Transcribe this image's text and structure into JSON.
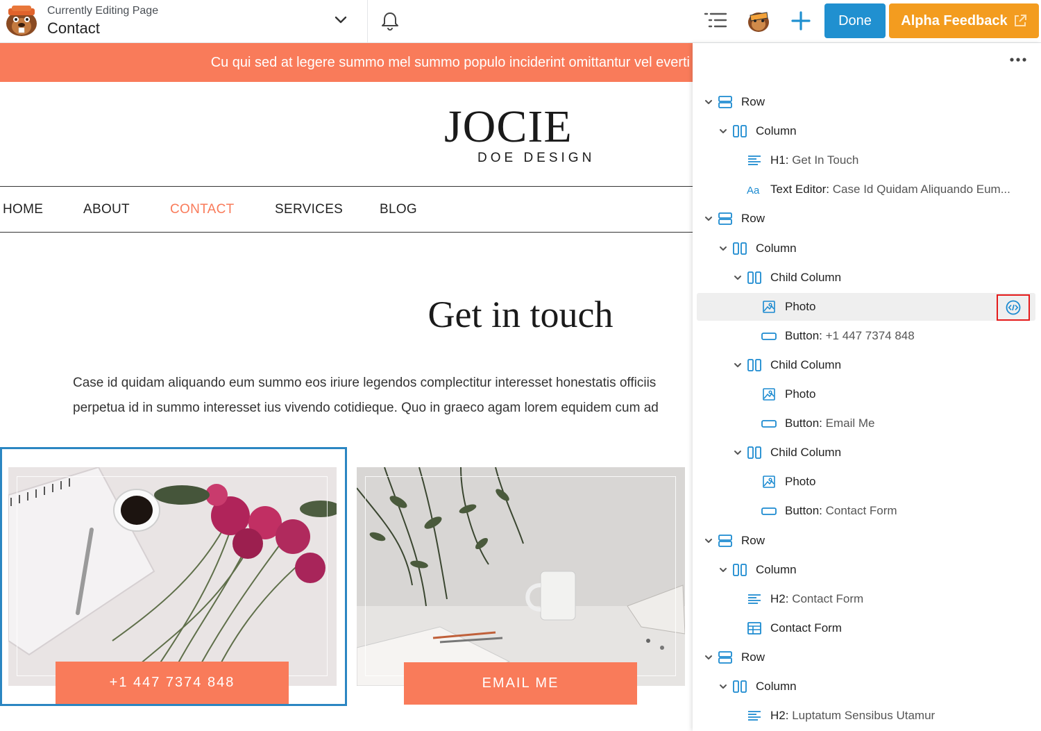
{
  "topbar": {
    "editing_label": "Currently Editing Page",
    "page_name": "Contact",
    "done_label": "Done",
    "feedback_label": "Alpha Feedback"
  },
  "site": {
    "announcement": "Cu qui sed at legere summo mel summo populo inciderint omittantur vel everti",
    "logo_main": "JOCIE",
    "logo_sub": "DOE DESIGN",
    "nav": [
      "HOME",
      "ABOUT",
      "CONTACT",
      "SERVICES",
      "BLOG"
    ],
    "nav_active": "CONTACT",
    "heading": "Get in touch",
    "body_lines": [
      "Case id quidam aliquando eum summo eos iriure legendos complectitur interesset honestatis officiis",
      "perpetua id in summo interesset ius vivendo cotidieque. Quo in graeco agam lorem equidem cum ad"
    ],
    "cta_phone": "+1 447 7374 848",
    "cta_email": "EMAIL ME"
  },
  "outline": {
    "items": [
      {
        "depth": 0,
        "icon": "row-icon",
        "type": "Row",
        "value": "",
        "expandable": true
      },
      {
        "depth": 1,
        "icon": "column-icon",
        "type": "Column",
        "value": "",
        "expandable": true
      },
      {
        "depth": 2,
        "icon": "heading-icon",
        "type": "H1:",
        "value": "Get In Touch",
        "expandable": false
      },
      {
        "depth": 2,
        "icon": "text-editor-icon",
        "type": "Text Editor:",
        "value": "Case Id Quidam Aliquando Eum...",
        "expandable": false
      },
      {
        "depth": 0,
        "icon": "row-icon",
        "type": "Row",
        "value": "",
        "expandable": true
      },
      {
        "depth": 1,
        "icon": "column-icon",
        "type": "Column",
        "value": "",
        "expandable": true
      },
      {
        "depth": 2,
        "icon": "column-icon",
        "type": "Child Column",
        "value": "",
        "expandable": true
      },
      {
        "depth": 3,
        "icon": "photo-icon",
        "type": "Photo",
        "value": "",
        "expandable": false,
        "highlight": true
      },
      {
        "depth": 3,
        "icon": "button-icon",
        "type": "Button:",
        "value": "+1 447 7374 848",
        "expandable": false
      },
      {
        "depth": 2,
        "icon": "column-icon",
        "type": "Child Column",
        "value": "",
        "expandable": true
      },
      {
        "depth": 3,
        "icon": "photo-icon",
        "type": "Photo",
        "value": "",
        "expandable": false
      },
      {
        "depth": 3,
        "icon": "button-icon",
        "type": "Button:",
        "value": "Email Me",
        "expandable": false
      },
      {
        "depth": 2,
        "icon": "column-icon",
        "type": "Child Column",
        "value": "",
        "expandable": true
      },
      {
        "depth": 3,
        "icon": "photo-icon",
        "type": "Photo",
        "value": "",
        "expandable": false
      },
      {
        "depth": 3,
        "icon": "button-icon",
        "type": "Button:",
        "value": "Contact Form",
        "expandable": false
      },
      {
        "depth": 0,
        "icon": "row-icon",
        "type": "Row",
        "value": "",
        "expandable": true
      },
      {
        "depth": 1,
        "icon": "column-icon",
        "type": "Column",
        "value": "",
        "expandable": true
      },
      {
        "depth": 2,
        "icon": "heading-icon",
        "type": "H2:",
        "value": "Contact Form",
        "expandable": false
      },
      {
        "depth": 2,
        "icon": "contact-form-icon",
        "type": "Contact Form",
        "value": "",
        "expandable": false
      },
      {
        "depth": 0,
        "icon": "row-icon",
        "type": "Row",
        "value": "",
        "expandable": true
      },
      {
        "depth": 1,
        "icon": "column-icon",
        "type": "Column",
        "value": "",
        "expandable": true
      },
      {
        "depth": 2,
        "icon": "heading-icon",
        "type": "H2:",
        "value": "Luptatum Sensibus Utamur",
        "expandable": false
      }
    ]
  },
  "colors": {
    "accent": "#f97b5a",
    "primary_blue": "#2090d0",
    "feedback_orange": "#f39c1f",
    "outline_icon_blue": "#1b8ad0",
    "selection_border": "#2b86c2",
    "highlight_box": "#e41a1a"
  }
}
